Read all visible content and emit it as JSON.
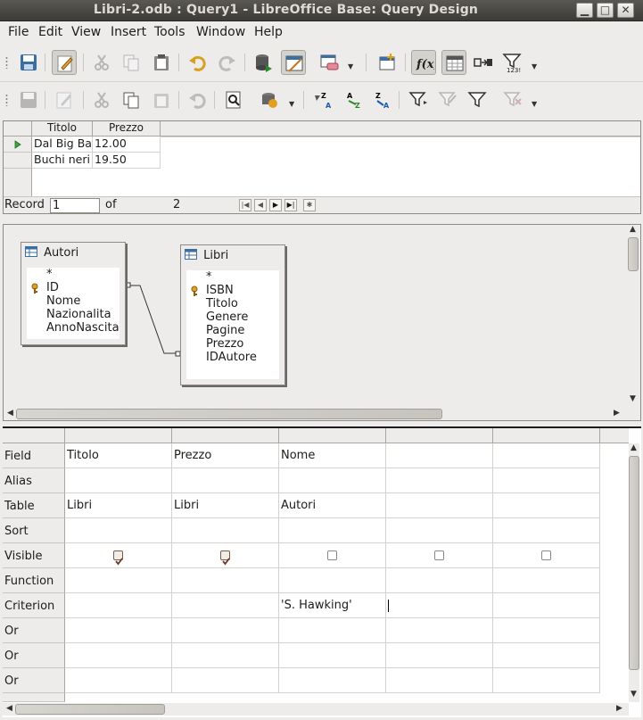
{
  "window": {
    "title": "Libri-2.odb : Query1 - LibreOffice Base: Query Design",
    "buttons": {
      "minimize": "▁",
      "maximize": "□",
      "close": "✕"
    }
  },
  "menu": [
    "File",
    "Edit",
    "View",
    "Insert",
    "Tools",
    "Window",
    "Help"
  ],
  "toolbar1": [
    "save",
    "edit",
    "cut",
    "copy",
    "paste",
    "undo",
    "redo",
    "run-query",
    "design-view",
    "clear-query",
    "add-tables",
    "functions",
    "table-names",
    "alias",
    "distinct-values"
  ],
  "toolbar2": [
    "save",
    "edit",
    "cut",
    "copy",
    "paste",
    "undo",
    "find",
    "refresh",
    "sort-asc",
    "sort",
    "sort-desc",
    "autofilter",
    "standard-filter",
    "apply-filter",
    "remove-filter"
  ],
  "result": {
    "columns": [
      "Titolo",
      "Prezzo"
    ],
    "rows": [
      [
        "Dal Big Ba",
        "12.00"
      ],
      [
        "Buchi neri",
        "19.50"
      ]
    ],
    "record_label": "Record",
    "record_value": "1",
    "of_label": "of",
    "total": "2"
  },
  "tables": [
    {
      "name": "Autori",
      "fields": [
        "*",
        "ID",
        "Nome",
        "Nazionalita",
        "AnnoNascita"
      ],
      "key_field": "ID"
    },
    {
      "name": "Libri",
      "fields": [
        "*",
        "ISBN",
        "Titolo",
        "Genere",
        "Pagine",
        "Prezzo",
        "IDAutore"
      ],
      "key_field": "ISBN"
    }
  ],
  "grid": {
    "row_labels": [
      "Field",
      "Alias",
      "Table",
      "Sort",
      "Visible",
      "Function",
      "Criterion",
      "Or",
      "Or",
      "Or"
    ],
    "columns": [
      {
        "field": "Titolo",
        "table": "Libri",
        "visible": true,
        "criterion": ""
      },
      {
        "field": "Prezzo",
        "table": "Libri",
        "visible": true,
        "criterion": ""
      },
      {
        "field": "Nome",
        "table": "Autori",
        "visible": false,
        "criterion": "'S. Hawking'"
      },
      {
        "field": "",
        "table": "",
        "visible": false,
        "criterion": ""
      },
      {
        "field": "",
        "table": "",
        "visible": false,
        "criterion": ""
      }
    ]
  }
}
